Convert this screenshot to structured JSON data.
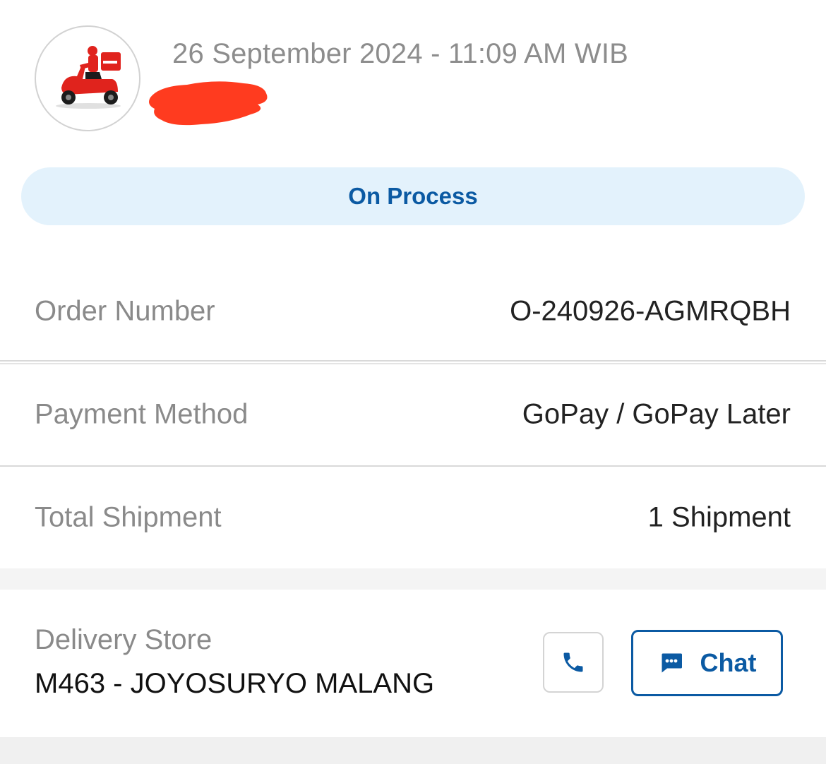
{
  "header": {
    "datetime": "26 September 2024 - 11:09 AM WIB",
    "avatar_icon": "delivery-scooter-icon"
  },
  "status": {
    "label": "On Process",
    "pill_color": "#e3f2fc",
    "text_color": "#0b5aa3"
  },
  "details": [
    {
      "label": "Order Number",
      "value": "O-240926-AGMRQBH"
    },
    {
      "label": "Payment Method",
      "value": "GoPay / GoPay Later"
    },
    {
      "label": "Total Shipment",
      "value": "1 Shipment"
    }
  ],
  "store": {
    "label": "Delivery Store",
    "name": "M463 - JOYOSURYO MALANG",
    "call_icon": "phone-icon",
    "chat_icon": "chat-bubble-icon",
    "chat_label": "Chat"
  },
  "colors": {
    "accent": "#0b5aa3",
    "redaction": "#ff3b1f"
  }
}
